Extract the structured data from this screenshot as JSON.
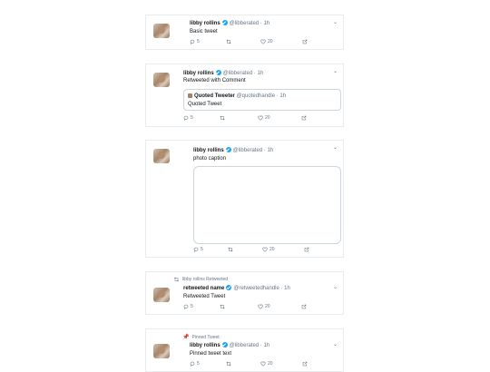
{
  "tweets": [
    {
      "name": "libby rollins",
      "handle": "@libberated",
      "dot": "·",
      "time": "1h",
      "text": "Basic tweet",
      "replies": "5",
      "likes": "20"
    },
    {
      "name": "libby rollins",
      "handle": "@libberated",
      "dot": "·",
      "time": "1h",
      "text": "Retweeted with Comment",
      "quote": {
        "name": "Quoted Tweeter",
        "handle": "@quotedhandle",
        "dot": "·",
        "time": "1h",
        "text": "Quoted Tweet"
      },
      "replies": "5",
      "likes": "20"
    },
    {
      "name": "libby rollins",
      "handle": "@libberated",
      "dot": "·",
      "time": "1h",
      "text": "photo caption",
      "replies": "5",
      "likes": "20"
    },
    {
      "social": "libby rollins Retweeted",
      "name": "retweeted name",
      "handle": "@retweetedhandle",
      "dot": "·",
      "time": "1h",
      "text": "Retweeted Tweet",
      "replies": "5",
      "likes": "20"
    },
    {
      "social": "Pinned Tweet",
      "name": "libby rollins",
      "handle": "@libberated",
      "dot": "·",
      "time": "1h",
      "text": "Pinned tweet text",
      "replies": "5",
      "likes": "20"
    }
  ],
  "icons": {
    "reply": "reply-icon",
    "retweet": "retweet-icon",
    "like": "heart-icon",
    "share": "share-icon",
    "caret": "chevron-down-icon",
    "verified": "verified-badge-icon",
    "pin": "pin-icon"
  },
  "colors": {
    "verified": "#1da1f2",
    "secondary_text": "#657786",
    "border": "#e6ecf0"
  }
}
